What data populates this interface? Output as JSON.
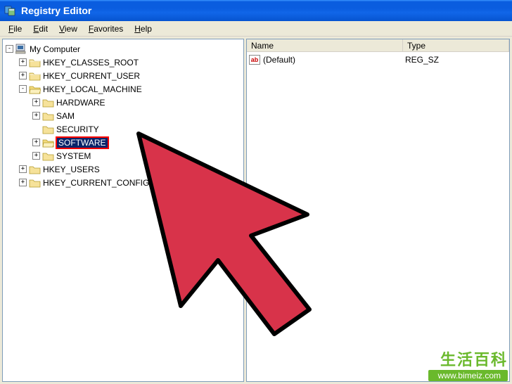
{
  "title": "Registry Editor",
  "menus": {
    "file": "File",
    "edit": "Edit",
    "view": "View",
    "favorites": "Favorites",
    "help": "Help"
  },
  "tree": {
    "root": "My Computer",
    "hkcr": "HKEY_CLASSES_ROOT",
    "hkcu": "HKEY_CURRENT_USER",
    "hklm": "HKEY_LOCAL_MACHINE",
    "hklm_children": {
      "hardware": "HARDWARE",
      "sam": "SAM",
      "security": "SECURITY",
      "software": "SOFTWARE",
      "system": "SYSTEM"
    },
    "hku": "HKEY_USERS",
    "hkcc": "HKEY_CURRENT_CONFIG"
  },
  "list": {
    "header_name": "Name",
    "header_type": "Type",
    "rows": [
      {
        "icon_text": "ab",
        "name": "(Default)",
        "type": "REG_SZ"
      }
    ]
  },
  "watermark": {
    "cn": "生活百科",
    "url": "www.bimeiz.com"
  }
}
